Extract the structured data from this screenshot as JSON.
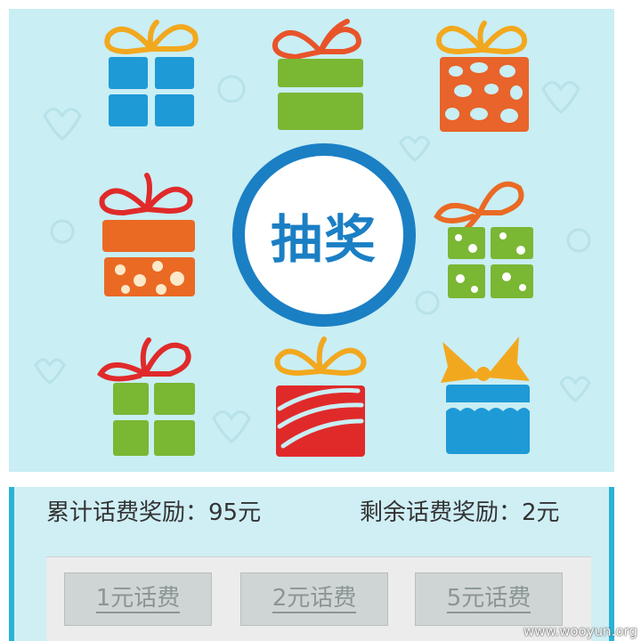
{
  "lottery": {
    "draw_label": "抽奖",
    "gifts": [
      {
        "name": "gift-blue",
        "box": "#1e9ad6",
        "ribbon": "#f2a81e"
      },
      {
        "name": "gift-green",
        "box": "#7ab733",
        "ribbon": "#e8542a"
      },
      {
        "name": "gift-orange-dots",
        "box": "#e8642a",
        "ribbon": "#f2a81e"
      },
      {
        "name": "gift-orange-white-dots",
        "box": "#ea6a24",
        "ribbon": "#e02a2a"
      },
      {
        "name": "gift-green-white-dots",
        "box": "#7ab733",
        "ribbon": "#ea6a24"
      },
      {
        "name": "gift-green-red-ribbon",
        "box": "#7ab733",
        "ribbon": "#e02a2a"
      },
      {
        "name": "gift-red-stripes",
        "box": "#e02a2a",
        "ribbon": "#f2a81e"
      },
      {
        "name": "gift-blue-wave",
        "box": "#1e9ad6",
        "ribbon": "#f2a81e"
      }
    ]
  },
  "rewards": {
    "total_text": "累计话费奖励：95元",
    "remaining_text": "剩余话费奖励：2元",
    "options": [
      "1元话费",
      "2元话费",
      "5元话费"
    ]
  },
  "watermark": "www.wooyun.org",
  "colors": {
    "panel_bg": "#c9eef4",
    "accent_blue": "#1b7fc4",
    "option_bg": "#cfd4d4",
    "option_text": "#8b9595"
  }
}
